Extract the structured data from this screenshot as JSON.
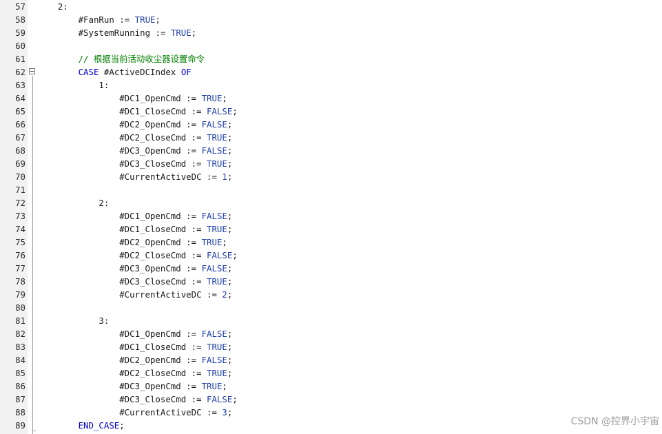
{
  "editor": {
    "lines": [
      {
        "n": "57",
        "indent": 4,
        "segs": [
          [
            "label",
            "2:"
          ]
        ]
      },
      {
        "n": "58",
        "indent": 8,
        "segs": [
          [
            "var",
            "#FanRun"
          ],
          [
            "op",
            " := "
          ],
          [
            "lit",
            "TRUE"
          ],
          [
            "punct",
            ";"
          ]
        ]
      },
      {
        "n": "59",
        "indent": 8,
        "segs": [
          [
            "var",
            "#SystemRunning"
          ],
          [
            "op",
            " := "
          ],
          [
            "lit",
            "TRUE"
          ],
          [
            "punct",
            ";"
          ]
        ]
      },
      {
        "n": "60",
        "indent": 0,
        "segs": []
      },
      {
        "n": "61",
        "indent": 8,
        "segs": [
          [
            "comment",
            "// 根据当前活动收尘器设置命令"
          ]
        ]
      },
      {
        "n": "62",
        "indent": 8,
        "segs": [
          [
            "kw",
            "CASE"
          ],
          [
            "op",
            " "
          ],
          [
            "var",
            "#ActiveDCIndex"
          ],
          [
            "op",
            " "
          ],
          [
            "kw",
            "OF"
          ]
        ]
      },
      {
        "n": "63",
        "indent": 12,
        "segs": [
          [
            "label",
            "1:"
          ]
        ]
      },
      {
        "n": "64",
        "indent": 16,
        "segs": [
          [
            "var",
            "#DC1_OpenCmd"
          ],
          [
            "op",
            " := "
          ],
          [
            "lit",
            "TRUE"
          ],
          [
            "punct",
            ";"
          ]
        ]
      },
      {
        "n": "65",
        "indent": 16,
        "segs": [
          [
            "var",
            "#DC1_CloseCmd"
          ],
          [
            "op",
            " := "
          ],
          [
            "lit",
            "FALSE"
          ],
          [
            "punct",
            ";"
          ]
        ]
      },
      {
        "n": "66",
        "indent": 16,
        "segs": [
          [
            "var",
            "#DC2_OpenCmd"
          ],
          [
            "op",
            " := "
          ],
          [
            "lit",
            "FALSE"
          ],
          [
            "punct",
            ";"
          ]
        ]
      },
      {
        "n": "67",
        "indent": 16,
        "segs": [
          [
            "var",
            "#DC2_CloseCmd"
          ],
          [
            "op",
            " := "
          ],
          [
            "lit",
            "TRUE"
          ],
          [
            "punct",
            ";"
          ]
        ]
      },
      {
        "n": "68",
        "indent": 16,
        "segs": [
          [
            "var",
            "#DC3_OpenCmd"
          ],
          [
            "op",
            " := "
          ],
          [
            "lit",
            "FALSE"
          ],
          [
            "punct",
            ";"
          ]
        ]
      },
      {
        "n": "69",
        "indent": 16,
        "segs": [
          [
            "var",
            "#DC3_CloseCmd"
          ],
          [
            "op",
            " := "
          ],
          [
            "lit",
            "TRUE"
          ],
          [
            "punct",
            ";"
          ]
        ]
      },
      {
        "n": "70",
        "indent": 16,
        "segs": [
          [
            "var",
            "#CurrentActiveDC"
          ],
          [
            "op",
            " := "
          ],
          [
            "num",
            "1"
          ],
          [
            "punct",
            ";"
          ]
        ]
      },
      {
        "n": "71",
        "indent": 0,
        "segs": []
      },
      {
        "n": "72",
        "indent": 12,
        "segs": [
          [
            "label",
            "2:"
          ]
        ]
      },
      {
        "n": "73",
        "indent": 16,
        "segs": [
          [
            "var",
            "#DC1_OpenCmd"
          ],
          [
            "op",
            " := "
          ],
          [
            "lit",
            "FALSE"
          ],
          [
            "punct",
            ";"
          ]
        ]
      },
      {
        "n": "74",
        "indent": 16,
        "segs": [
          [
            "var",
            "#DC1_CloseCmd"
          ],
          [
            "op",
            " := "
          ],
          [
            "lit",
            "TRUE"
          ],
          [
            "punct",
            ";"
          ]
        ]
      },
      {
        "n": "75",
        "indent": 16,
        "segs": [
          [
            "var",
            "#DC2_OpenCmd"
          ],
          [
            "op",
            " := "
          ],
          [
            "lit",
            "TRUE"
          ],
          [
            "punct",
            ";"
          ]
        ]
      },
      {
        "n": "76",
        "indent": 16,
        "segs": [
          [
            "var",
            "#DC2_CloseCmd"
          ],
          [
            "op",
            " := "
          ],
          [
            "lit",
            "FALSE"
          ],
          [
            "punct",
            ";"
          ]
        ]
      },
      {
        "n": "77",
        "indent": 16,
        "segs": [
          [
            "var",
            "#DC3_OpenCmd"
          ],
          [
            "op",
            " := "
          ],
          [
            "lit",
            "FALSE"
          ],
          [
            "punct",
            ";"
          ]
        ]
      },
      {
        "n": "78",
        "indent": 16,
        "segs": [
          [
            "var",
            "#DC3_CloseCmd"
          ],
          [
            "op",
            " := "
          ],
          [
            "lit",
            "TRUE"
          ],
          [
            "punct",
            ";"
          ]
        ]
      },
      {
        "n": "79",
        "indent": 16,
        "segs": [
          [
            "var",
            "#CurrentActiveDC"
          ],
          [
            "op",
            " := "
          ],
          [
            "num",
            "2"
          ],
          [
            "punct",
            ";"
          ]
        ]
      },
      {
        "n": "80",
        "indent": 0,
        "segs": []
      },
      {
        "n": "81",
        "indent": 12,
        "segs": [
          [
            "label",
            "3:"
          ]
        ]
      },
      {
        "n": "82",
        "indent": 16,
        "segs": [
          [
            "var",
            "#DC1_OpenCmd"
          ],
          [
            "op",
            " := "
          ],
          [
            "lit",
            "FALSE"
          ],
          [
            "punct",
            ";"
          ]
        ]
      },
      {
        "n": "83",
        "indent": 16,
        "segs": [
          [
            "var",
            "#DC1_CloseCmd"
          ],
          [
            "op",
            " := "
          ],
          [
            "lit",
            "TRUE"
          ],
          [
            "punct",
            ";"
          ]
        ]
      },
      {
        "n": "84",
        "indent": 16,
        "segs": [
          [
            "var",
            "#DC2_OpenCmd"
          ],
          [
            "op",
            " := "
          ],
          [
            "lit",
            "FALSE"
          ],
          [
            "punct",
            ";"
          ]
        ]
      },
      {
        "n": "85",
        "indent": 16,
        "segs": [
          [
            "var",
            "#DC2_CloseCmd"
          ],
          [
            "op",
            " := "
          ],
          [
            "lit",
            "TRUE"
          ],
          [
            "punct",
            ";"
          ]
        ]
      },
      {
        "n": "86",
        "indent": 16,
        "segs": [
          [
            "var",
            "#DC3_OpenCmd"
          ],
          [
            "op",
            " := "
          ],
          [
            "lit",
            "TRUE"
          ],
          [
            "punct",
            ";"
          ]
        ]
      },
      {
        "n": "87",
        "indent": 16,
        "segs": [
          [
            "var",
            "#DC3_CloseCmd"
          ],
          [
            "op",
            " := "
          ],
          [
            "lit",
            "FALSE"
          ],
          [
            "punct",
            ";"
          ]
        ]
      },
      {
        "n": "88",
        "indent": 16,
        "segs": [
          [
            "var",
            "#CurrentActiveDC"
          ],
          [
            "op",
            " := "
          ],
          [
            "num",
            "3"
          ],
          [
            "punct",
            ";"
          ]
        ]
      },
      {
        "n": "89",
        "indent": 8,
        "segs": [
          [
            "kw",
            "END_CASE"
          ],
          [
            "punct",
            ";"
          ]
        ]
      }
    ]
  },
  "watermark": "CSDN @控界小宇宙",
  "colors": {
    "keyword": "#0000cc",
    "literal": "#1f3fa8",
    "comment": "#008000",
    "gutter_bg": "#f2f2f2"
  }
}
